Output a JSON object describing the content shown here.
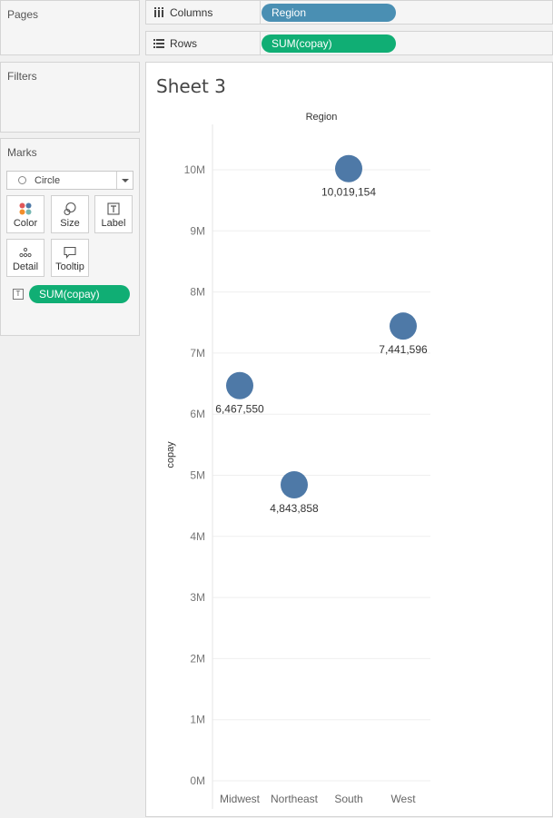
{
  "pages": {
    "title": "Pages"
  },
  "filters": {
    "title": "Filters"
  },
  "marks": {
    "title": "Marks",
    "mark_type": "Circle",
    "cards": {
      "color": "Color",
      "size": "Size",
      "label": "Label",
      "detail": "Detail",
      "tooltip": "Tooltip"
    },
    "label_field": "SUM(copay)"
  },
  "shelves": {
    "columns": {
      "label": "Columns",
      "pill": "Region"
    },
    "rows": {
      "label": "Rows",
      "pill": "SUM(copay)"
    }
  },
  "colors": {
    "dimension_pill": "#4a8fb3",
    "measure_pill": "#10ae74",
    "mark": "#4e79a7"
  },
  "sheet": {
    "title": "Sheet 3"
  },
  "chart_data": {
    "type": "scatter",
    "title": "",
    "column_header": "Region",
    "xlabel": "",
    "ylabel": "copay",
    "categories": [
      "Midwest",
      "Northeast",
      "South",
      "West"
    ],
    "values": [
      6467550,
      4843858,
      10019154,
      7441596
    ],
    "data_labels": [
      "6,467,550",
      "4,843,858",
      "10,019,154",
      "7,441,596"
    ],
    "ylim": [
      0,
      10500000
    ],
    "yticks": [
      0,
      1000000,
      2000000,
      3000000,
      4000000,
      5000000,
      6000000,
      7000000,
      8000000,
      9000000,
      10000000
    ],
    "ytick_labels": [
      "0M",
      "1M",
      "2M",
      "3M",
      "4M",
      "5M",
      "6M",
      "7M",
      "8M",
      "9M",
      "10M"
    ],
    "grid": true,
    "legend": "none"
  }
}
